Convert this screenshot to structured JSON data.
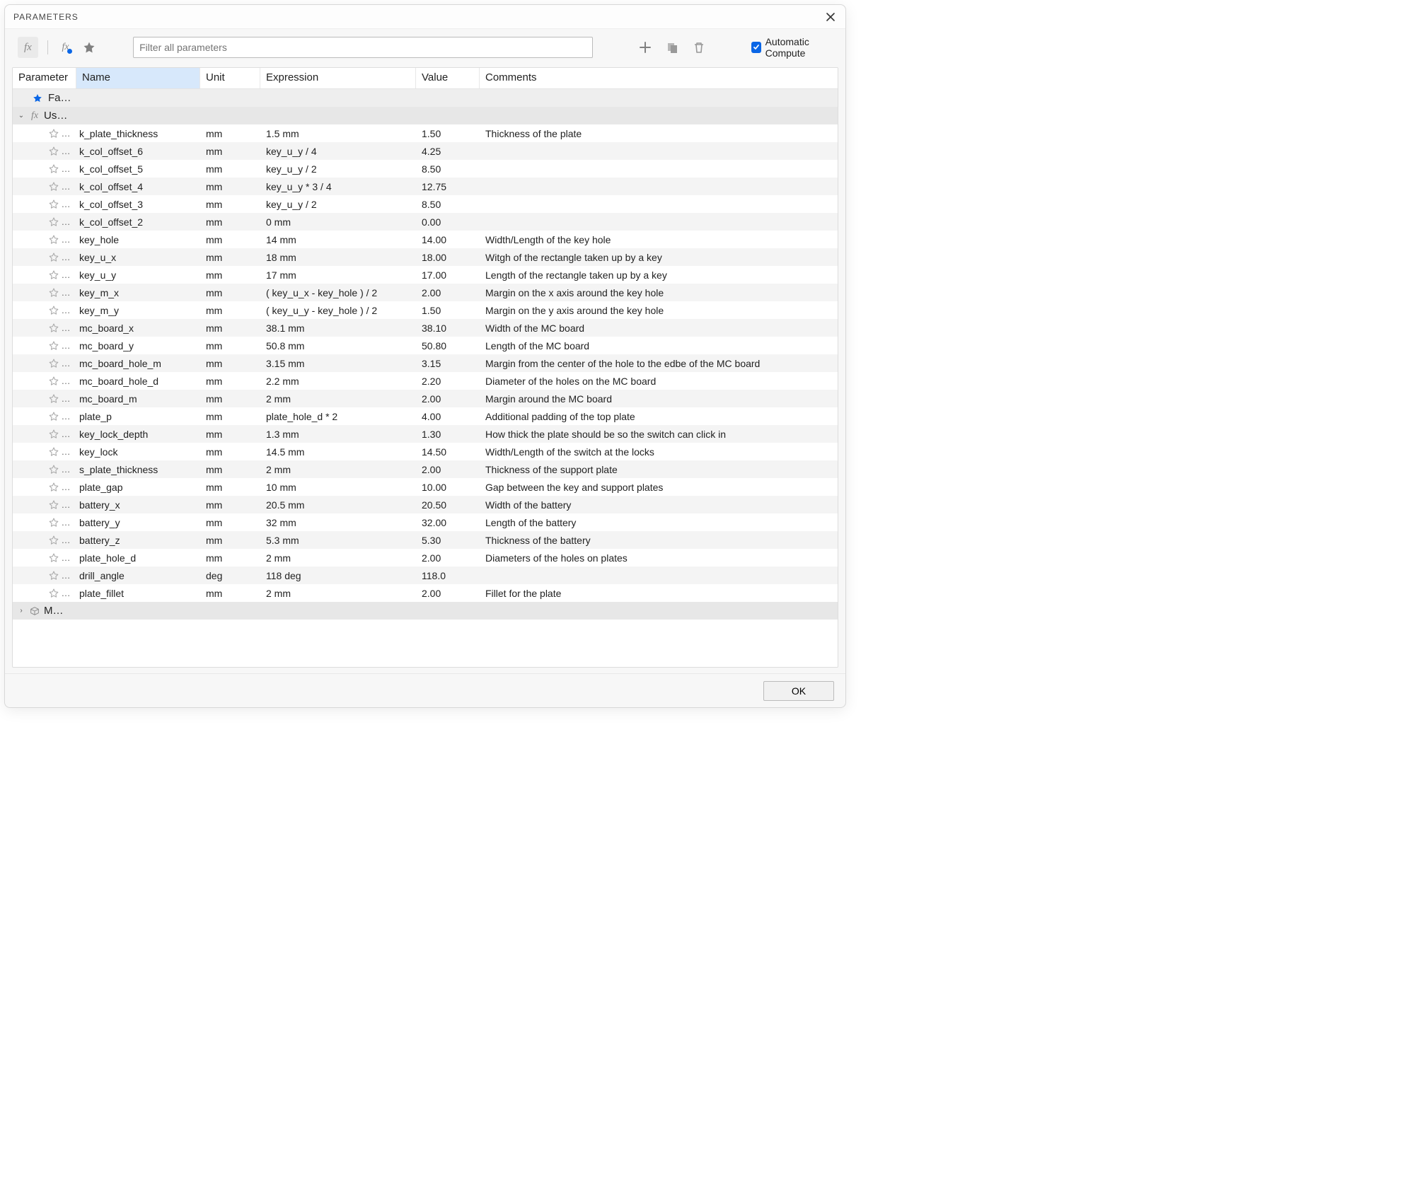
{
  "title": "PARAMETERS",
  "toolbar": {
    "fx_main": "fx",
    "fx_user": "fx",
    "filter_placeholder": "Filter all parameters",
    "auto_compute_label": "Automatic Compute",
    "auto_compute_checked": true
  },
  "columns": {
    "parameter": "Parameter",
    "name": "Name",
    "unit": "Unit",
    "expression": "Expression",
    "value": "Value",
    "comments": "Comments"
  },
  "groups": {
    "favorites": "Fa…",
    "user": "Us…",
    "model": "M…"
  },
  "buttons": {
    "ok": "OK"
  },
  "rows": [
    {
      "name": "k_plate_thickness",
      "unit": "mm",
      "expression": "1.5 mm",
      "value": "1.50",
      "comments": "Thickness of the plate"
    },
    {
      "name": "k_col_offset_6",
      "unit": "mm",
      "expression": "key_u_y / 4",
      "value": "4.25",
      "comments": ""
    },
    {
      "name": "k_col_offset_5",
      "unit": "mm",
      "expression": "key_u_y / 2",
      "value": "8.50",
      "comments": ""
    },
    {
      "name": "k_col_offset_4",
      "unit": "mm",
      "expression": "key_u_y * 3 / 4",
      "value": "12.75",
      "comments": ""
    },
    {
      "name": "k_col_offset_3",
      "unit": "mm",
      "expression": "key_u_y / 2",
      "value": "8.50",
      "comments": ""
    },
    {
      "name": "k_col_offset_2",
      "unit": "mm",
      "expression": "0 mm",
      "value": "0.00",
      "comments": ""
    },
    {
      "name": "key_hole",
      "unit": "mm",
      "expression": "14 mm",
      "value": "14.00",
      "comments": "Width/Length of the key hole"
    },
    {
      "name": "key_u_x",
      "unit": "mm",
      "expression": "18 mm",
      "value": "18.00",
      "comments": "Witgh of the rectangle taken up by a key"
    },
    {
      "name": "key_u_y",
      "unit": "mm",
      "expression": "17 mm",
      "value": "17.00",
      "comments": "Length of the rectangle taken up by a key"
    },
    {
      "name": "key_m_x",
      "unit": "mm",
      "expression": "( key_u_x - key_hole ) / 2",
      "value": "2.00",
      "comments": "Margin on the x axis around the key hole"
    },
    {
      "name": "key_m_y",
      "unit": "mm",
      "expression": "( key_u_y - key_hole ) / 2",
      "value": "1.50",
      "comments": "Margin on the y axis around the key hole"
    },
    {
      "name": "mc_board_x",
      "unit": "mm",
      "expression": "38.1 mm",
      "value": "38.10",
      "comments": "Width of the MC board"
    },
    {
      "name": "mc_board_y",
      "unit": "mm",
      "expression": "50.8 mm",
      "value": "50.80",
      "comments": "Length of the MC board"
    },
    {
      "name": "mc_board_hole_m",
      "unit": "mm",
      "expression": "3.15 mm",
      "value": "3.15",
      "comments": "Margin from the center of the hole to the edbe of the MC board"
    },
    {
      "name": "mc_board_hole_d",
      "unit": "mm",
      "expression": "2.2 mm",
      "value": "2.20",
      "comments": "Diameter of the holes on the MC board"
    },
    {
      "name": "mc_board_m",
      "unit": "mm",
      "expression": "2 mm",
      "value": "2.00",
      "comments": "Margin around the MC board"
    },
    {
      "name": "plate_p",
      "unit": "mm",
      "expression": "plate_hole_d * 2",
      "value": "4.00",
      "comments": "Additional padding of the top plate"
    },
    {
      "name": "key_lock_depth",
      "unit": "mm",
      "expression": "1.3 mm",
      "value": "1.30",
      "comments": "How thick the plate should be so the switch can click in"
    },
    {
      "name": "key_lock",
      "unit": "mm",
      "expression": "14.5 mm",
      "value": "14.50",
      "comments": "Width/Length of the switch at the locks"
    },
    {
      "name": "s_plate_thickness",
      "unit": "mm",
      "expression": "2 mm",
      "value": "2.00",
      "comments": "Thickness of the support plate"
    },
    {
      "name": "plate_gap",
      "unit": "mm",
      "expression": "10 mm",
      "value": "10.00",
      "comments": "Gap between the key and support plates"
    },
    {
      "name": "battery_x",
      "unit": "mm",
      "expression": "20.5 mm",
      "value": "20.50",
      "comments": "Width of the battery"
    },
    {
      "name": "battery_y",
      "unit": "mm",
      "expression": "32 mm",
      "value": "32.00",
      "comments": "Length of the battery"
    },
    {
      "name": "battery_z",
      "unit": "mm",
      "expression": "5.3 mm",
      "value": "5.30",
      "comments": "Thickness of the battery"
    },
    {
      "name": "plate_hole_d",
      "unit": "mm",
      "expression": "2 mm",
      "value": "2.00",
      "comments": "Diameters of the holes on plates"
    },
    {
      "name": "drill_angle",
      "unit": "deg",
      "expression": "118 deg",
      "value": "118.0",
      "comments": ""
    },
    {
      "name": "plate_fillet",
      "unit": "mm",
      "expression": "2 mm",
      "value": "2.00",
      "comments": "Fillet for the plate"
    }
  ]
}
